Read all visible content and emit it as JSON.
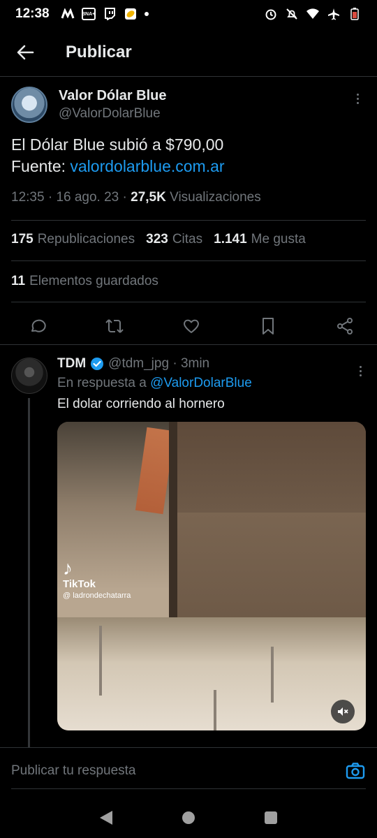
{
  "status_bar": {
    "time": "12:38",
    "bna_label": "BNA+"
  },
  "header": {
    "title": "Publicar"
  },
  "tweet": {
    "author_name": "Valor Dólar Blue",
    "author_handle": "@ValorDolarBlue",
    "text_line1": "El Dólar Blue subió a $790,00",
    "text_source_prefix": "Fuente: ",
    "text_link": "valordolarblue.com.ar",
    "time": "12:35",
    "date": "16 ago. 23",
    "views_count": "27,5K",
    "views_label": "Visualizaciones",
    "reposts_count": "175",
    "reposts_label": "Republicaciones",
    "quotes_count": "323",
    "quotes_label": "Citas",
    "likes_count": "1.141",
    "likes_label": "Me gusta",
    "bookmarks_count": "11",
    "bookmarks_label": "Elementos guardados"
  },
  "reply": {
    "name": "TDM",
    "handle": "@tdm_jpg",
    "time": "3min",
    "reply_to_prefix": "En respuesta a ",
    "reply_to_handle": "@ValorDolarBlue",
    "text": "El dolar corriendo al hornero",
    "media": {
      "watermark_app": "TikTok",
      "watermark_user": "@ ladrondechatarra"
    }
  },
  "compose": {
    "placeholder": "Publicar tu respuesta"
  },
  "colors": {
    "accent": "#1d9bf0",
    "background": "#000000",
    "muted": "#71767b",
    "text": "#e7e9ea"
  }
}
